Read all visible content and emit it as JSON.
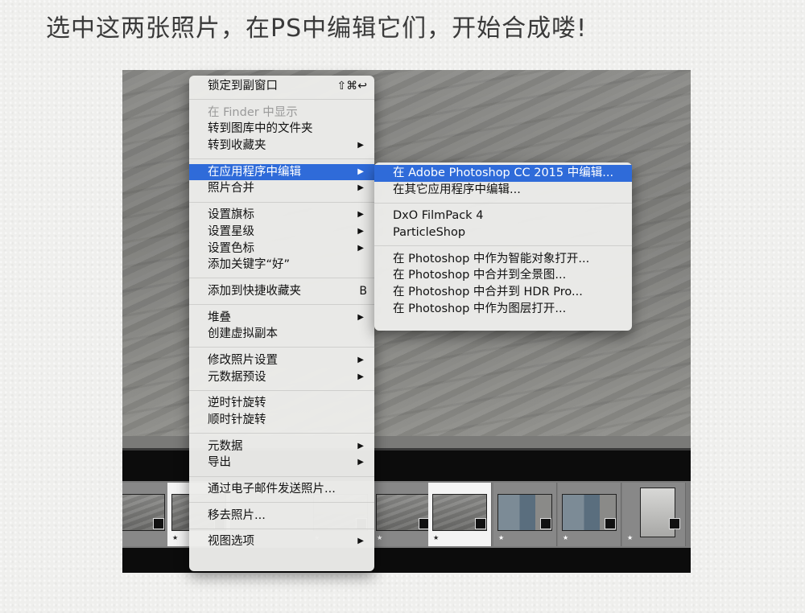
{
  "caption": "选中这两张照片，在PS中编辑它们，开始合成喽!",
  "main_menu": {
    "groups": [
      [
        {
          "label": "锁定到副窗口",
          "shortcut": "⇧⌘↩"
        }
      ],
      [
        {
          "label": "在 Finder 中显示",
          "disabled": true
        },
        {
          "label": "转到图库中的文件夹"
        },
        {
          "label": "转到收藏夹",
          "submenu": true
        }
      ],
      [
        {
          "label": "在应用程序中编辑",
          "submenu": true,
          "highlighted": true
        },
        {
          "label": "照片合并",
          "submenu": true
        }
      ],
      [
        {
          "label": "设置旗标",
          "submenu": true
        },
        {
          "label": "设置星级",
          "submenu": true
        },
        {
          "label": "设置色标",
          "submenu": true
        },
        {
          "label": "添加关键字“好”"
        }
      ],
      [
        {
          "label": "添加到快捷收藏夹",
          "shortcut": "B"
        }
      ],
      [
        {
          "label": "堆叠",
          "submenu": true
        },
        {
          "label": "创建虚拟副本"
        }
      ],
      [
        {
          "label": "修改照片设置",
          "submenu": true
        },
        {
          "label": "元数据预设",
          "submenu": true
        }
      ],
      [
        {
          "label": "逆时针旋转"
        },
        {
          "label": "顺时针旋转"
        }
      ],
      [
        {
          "label": "元数据",
          "submenu": true
        },
        {
          "label": "导出",
          "submenu": true
        }
      ],
      [
        {
          "label": "通过电子邮件发送照片..."
        }
      ],
      [
        {
          "label": "移去照片..."
        }
      ],
      [
        {
          "label": "视图选项",
          "submenu": true
        }
      ]
    ]
  },
  "sub_menu": {
    "groups": [
      [
        {
          "label": "在 Adobe Photoshop CC 2015 中编辑...",
          "highlighted": true
        },
        {
          "label": "在其它应用程序中编辑..."
        }
      ],
      [
        {
          "label": "DxO FilmPack 4"
        },
        {
          "label": "ParticleShop"
        }
      ],
      [
        {
          "label": "在 Photoshop 中作为智能对象打开..."
        },
        {
          "label": "在 Photoshop 中合并到全景图..."
        },
        {
          "label": "在 Photoshop 中合并到 HDR Pro..."
        },
        {
          "label": "在 Photoshop 中作为图层打开..."
        }
      ]
    ]
  },
  "filmstrip": {
    "star_glyph": "★",
    "thumbnails": [
      {
        "style": "floor",
        "selected": false
      },
      {
        "style": "floor",
        "selected": true
      },
      {
        "style": "floor",
        "selected": false
      },
      {
        "style": "floor",
        "selected": false
      },
      {
        "style": "floor",
        "selected": true
      },
      {
        "style": "blue",
        "selected": false
      },
      {
        "style": "blue",
        "selected": false
      },
      {
        "style": "portrait",
        "selected": false
      }
    ]
  },
  "colors": {
    "highlight": "#2f6bd9",
    "menu_bg": "#ececea"
  }
}
